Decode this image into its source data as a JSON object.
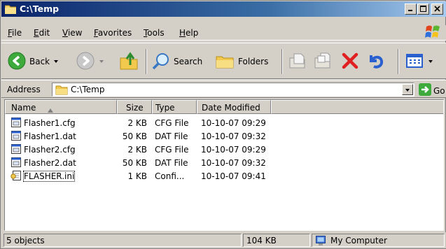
{
  "window": {
    "title": "C:\\Temp"
  },
  "menu": [
    {
      "label": "File",
      "ul": "F",
      "rest": "ile"
    },
    {
      "label": "Edit",
      "ul": "E",
      "rest": "dit"
    },
    {
      "label": "View",
      "ul": "V",
      "rest": "iew"
    },
    {
      "label": "Favorites",
      "ul": "F",
      "rest": "avorites",
      "ul_index": 0
    },
    {
      "label": "Tools",
      "ul": "T",
      "rest": "ools"
    },
    {
      "label": "Help",
      "ul": "H",
      "rest": "elp"
    }
  ],
  "toolbar": {
    "back_label": "Back",
    "search_label": "Search",
    "folders_label": "Folders"
  },
  "address": {
    "label": "Address",
    "value": "C:\\Temp",
    "go_label": "Go"
  },
  "columns": {
    "name": "Name",
    "size": "Size",
    "type": "Type",
    "date": "Date Modified"
  },
  "files": [
    {
      "name": "Flasher1.cfg",
      "size": "2 KB",
      "type": "CFG File",
      "date": "10-10-07 09:29",
      "icon": "cfg-file-icon"
    },
    {
      "name": "Flasher1.dat",
      "size": "50 KB",
      "type": "DAT File",
      "date": "10-10-07 09:32",
      "icon": "dat-file-icon"
    },
    {
      "name": "Flasher2.cfg",
      "size": "2 KB",
      "type": "CFG File",
      "date": "10-10-07 09:29",
      "icon": "cfg-file-icon"
    },
    {
      "name": "Flasher2.dat",
      "size": "50 KB",
      "type": "DAT File",
      "date": "10-10-07 09:32",
      "icon": "dat-file-icon"
    },
    {
      "name": "FLASHER.ini",
      "size": "1 KB",
      "type": "Confi...",
      "date": "10-10-07 09:41",
      "icon": "ini-file-icon"
    }
  ],
  "status": {
    "objects": "5 objects",
    "size": "104 KB",
    "location": "My Computer"
  },
  "colors": {
    "title_gradient_start": "#0a246a",
    "title_gradient_end": "#a6caf0",
    "chrome": "#d4d0c8"
  }
}
